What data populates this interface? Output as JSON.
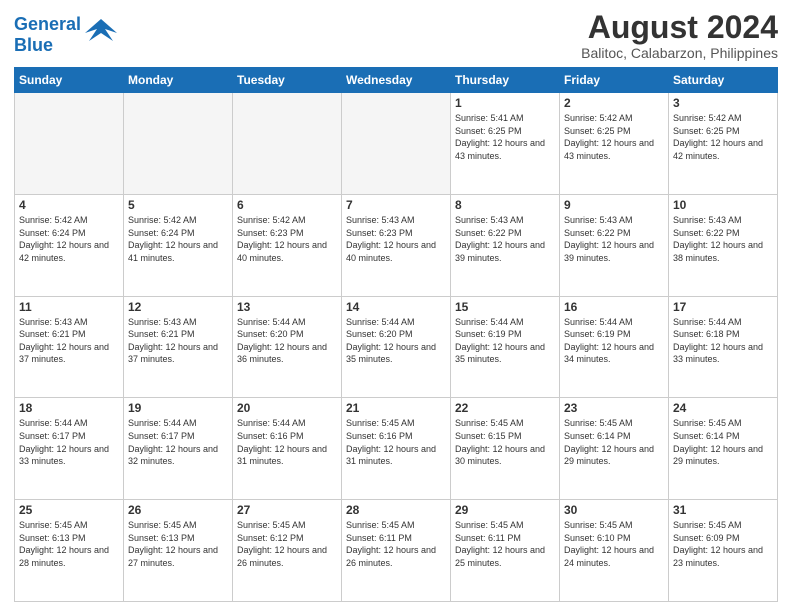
{
  "logo": {
    "line1": "General",
    "line2": "Blue"
  },
  "title": "August 2024",
  "subtitle": "Balitoc, Calabarzon, Philippines",
  "weekdays": [
    "Sunday",
    "Monday",
    "Tuesday",
    "Wednesday",
    "Thursday",
    "Friday",
    "Saturday"
  ],
  "weeks": [
    [
      {
        "day": "",
        "empty": true
      },
      {
        "day": "",
        "empty": true
      },
      {
        "day": "",
        "empty": true
      },
      {
        "day": "",
        "empty": true
      },
      {
        "day": "1",
        "sunrise": "5:41 AM",
        "sunset": "6:25 PM",
        "daylight": "12 hours and 43 minutes."
      },
      {
        "day": "2",
        "sunrise": "5:42 AM",
        "sunset": "6:25 PM",
        "daylight": "12 hours and 43 minutes."
      },
      {
        "day": "3",
        "sunrise": "5:42 AM",
        "sunset": "6:25 PM",
        "daylight": "12 hours and 42 minutes."
      }
    ],
    [
      {
        "day": "4",
        "sunrise": "5:42 AM",
        "sunset": "6:24 PM",
        "daylight": "12 hours and 42 minutes."
      },
      {
        "day": "5",
        "sunrise": "5:42 AM",
        "sunset": "6:24 PM",
        "daylight": "12 hours and 41 minutes."
      },
      {
        "day": "6",
        "sunrise": "5:42 AM",
        "sunset": "6:23 PM",
        "daylight": "12 hours and 40 minutes."
      },
      {
        "day": "7",
        "sunrise": "5:43 AM",
        "sunset": "6:23 PM",
        "daylight": "12 hours and 40 minutes."
      },
      {
        "day": "8",
        "sunrise": "5:43 AM",
        "sunset": "6:22 PM",
        "daylight": "12 hours and 39 minutes."
      },
      {
        "day": "9",
        "sunrise": "5:43 AM",
        "sunset": "6:22 PM",
        "daylight": "12 hours and 39 minutes."
      },
      {
        "day": "10",
        "sunrise": "5:43 AM",
        "sunset": "6:22 PM",
        "daylight": "12 hours and 38 minutes."
      }
    ],
    [
      {
        "day": "11",
        "sunrise": "5:43 AM",
        "sunset": "6:21 PM",
        "daylight": "12 hours and 37 minutes."
      },
      {
        "day": "12",
        "sunrise": "5:43 AM",
        "sunset": "6:21 PM",
        "daylight": "12 hours and 37 minutes."
      },
      {
        "day": "13",
        "sunrise": "5:44 AM",
        "sunset": "6:20 PM",
        "daylight": "12 hours and 36 minutes."
      },
      {
        "day": "14",
        "sunrise": "5:44 AM",
        "sunset": "6:20 PM",
        "daylight": "12 hours and 35 minutes."
      },
      {
        "day": "15",
        "sunrise": "5:44 AM",
        "sunset": "6:19 PM",
        "daylight": "12 hours and 35 minutes."
      },
      {
        "day": "16",
        "sunrise": "5:44 AM",
        "sunset": "6:19 PM",
        "daylight": "12 hours and 34 minutes."
      },
      {
        "day": "17",
        "sunrise": "5:44 AM",
        "sunset": "6:18 PM",
        "daylight": "12 hours and 33 minutes."
      }
    ],
    [
      {
        "day": "18",
        "sunrise": "5:44 AM",
        "sunset": "6:17 PM",
        "daylight": "12 hours and 33 minutes."
      },
      {
        "day": "19",
        "sunrise": "5:44 AM",
        "sunset": "6:17 PM",
        "daylight": "12 hours and 32 minutes."
      },
      {
        "day": "20",
        "sunrise": "5:44 AM",
        "sunset": "6:16 PM",
        "daylight": "12 hours and 31 minutes."
      },
      {
        "day": "21",
        "sunrise": "5:45 AM",
        "sunset": "6:16 PM",
        "daylight": "12 hours and 31 minutes."
      },
      {
        "day": "22",
        "sunrise": "5:45 AM",
        "sunset": "6:15 PM",
        "daylight": "12 hours and 30 minutes."
      },
      {
        "day": "23",
        "sunrise": "5:45 AM",
        "sunset": "6:14 PM",
        "daylight": "12 hours and 29 minutes."
      },
      {
        "day": "24",
        "sunrise": "5:45 AM",
        "sunset": "6:14 PM",
        "daylight": "12 hours and 29 minutes."
      }
    ],
    [
      {
        "day": "25",
        "sunrise": "5:45 AM",
        "sunset": "6:13 PM",
        "daylight": "12 hours and 28 minutes."
      },
      {
        "day": "26",
        "sunrise": "5:45 AM",
        "sunset": "6:13 PM",
        "daylight": "12 hours and 27 minutes."
      },
      {
        "day": "27",
        "sunrise": "5:45 AM",
        "sunset": "6:12 PM",
        "daylight": "12 hours and 26 minutes."
      },
      {
        "day": "28",
        "sunrise": "5:45 AM",
        "sunset": "6:11 PM",
        "daylight": "12 hours and 26 minutes."
      },
      {
        "day": "29",
        "sunrise": "5:45 AM",
        "sunset": "6:11 PM",
        "daylight": "12 hours and 25 minutes."
      },
      {
        "day": "30",
        "sunrise": "5:45 AM",
        "sunset": "6:10 PM",
        "daylight": "12 hours and 24 minutes."
      },
      {
        "day": "31",
        "sunrise": "5:45 AM",
        "sunset": "6:09 PM",
        "daylight": "12 hours and 23 minutes."
      }
    ]
  ]
}
